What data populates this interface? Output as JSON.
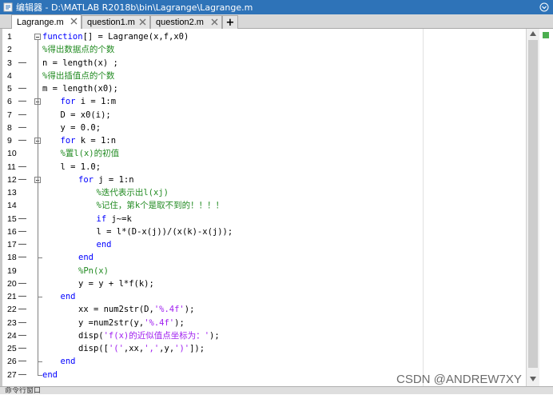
{
  "window": {
    "title": "编辑器 - D:\\MATLAB R2018b\\bin\\Lagrange\\Lagrange.m"
  },
  "tabs": [
    {
      "label": "Lagrange.m",
      "active": true
    },
    {
      "label": "question1.m",
      "active": false
    },
    {
      "label": "question2.m",
      "active": false
    }
  ],
  "tab_add_label": "+",
  "editor": {
    "lines": [
      {
        "n": "1",
        "dash": "",
        "indent": 0,
        "tokens": [
          {
            "c": "kw",
            "t": "function"
          },
          {
            "c": "tx",
            "t": "[] = Lagrange(x,f,x0)"
          }
        ]
      },
      {
        "n": "2",
        "dash": "",
        "indent": 0,
        "tokens": [
          {
            "c": "cm",
            "t": "%得出数据点的个数"
          }
        ]
      },
      {
        "n": "3",
        "dash": "—",
        "indent": 0,
        "tokens": [
          {
            "c": "tx",
            "t": "n = length(x) ;"
          }
        ]
      },
      {
        "n": "4",
        "dash": "",
        "indent": 0,
        "tokens": [
          {
            "c": "cm",
            "t": "%得出插值点的个数"
          }
        ]
      },
      {
        "n": "5",
        "dash": "—",
        "indent": 0,
        "tokens": [
          {
            "c": "tx",
            "t": "m = length(x0);"
          }
        ]
      },
      {
        "n": "6",
        "dash": "—",
        "indent": 1,
        "tokens": [
          {
            "c": "kw",
            "t": "for"
          },
          {
            "c": "tx",
            "t": " i = 1:m"
          }
        ]
      },
      {
        "n": "7",
        "dash": "—",
        "indent": 1,
        "tokens": [
          {
            "c": "tx",
            "t": "D = x0(i);"
          }
        ]
      },
      {
        "n": "8",
        "dash": "—",
        "indent": 1,
        "tokens": [
          {
            "c": "tx",
            "t": "y = 0.0;"
          }
        ]
      },
      {
        "n": "9",
        "dash": "—",
        "indent": 1,
        "tokens": [
          {
            "c": "kw",
            "t": "for"
          },
          {
            "c": "tx",
            "t": " k = 1:n"
          }
        ]
      },
      {
        "n": "10",
        "dash": "",
        "indent": 1,
        "tokens": [
          {
            "c": "cm",
            "t": "%置l(x)的初值"
          }
        ]
      },
      {
        "n": "11",
        "dash": "—",
        "indent": 1,
        "tokens": [
          {
            "c": "tx",
            "t": "l = 1.0;"
          }
        ]
      },
      {
        "n": "12",
        "dash": "—",
        "indent": 2,
        "tokens": [
          {
            "c": "kw",
            "t": "for"
          },
          {
            "c": "tx",
            "t": " j = 1:n"
          }
        ]
      },
      {
        "n": "13",
        "dash": "",
        "indent": 3,
        "tokens": [
          {
            "c": "cm",
            "t": "%迭代表示出l(xj)"
          }
        ]
      },
      {
        "n": "14",
        "dash": "",
        "indent": 3,
        "tokens": [
          {
            "c": "cm",
            "t": "%记住，第k个是取不到的！！！！"
          }
        ]
      },
      {
        "n": "15",
        "dash": "—",
        "indent": 3,
        "tokens": [
          {
            "c": "kw",
            "t": "if"
          },
          {
            "c": "tx",
            "t": " j~=k"
          }
        ]
      },
      {
        "n": "16",
        "dash": "—",
        "indent": 3,
        "tokens": [
          {
            "c": "tx",
            "t": "l = l*(D-x(j))/(x(k)-x(j));"
          }
        ]
      },
      {
        "n": "17",
        "dash": "—",
        "indent": 3,
        "tokens": [
          {
            "c": "kw",
            "t": "end"
          }
        ]
      },
      {
        "n": "18",
        "dash": "—",
        "indent": 2,
        "tokens": [
          {
            "c": "kw",
            "t": "end"
          }
        ]
      },
      {
        "n": "19",
        "dash": "",
        "indent": 2,
        "tokens": [
          {
            "c": "cm",
            "t": "%Pn(x)"
          }
        ]
      },
      {
        "n": "20",
        "dash": "—",
        "indent": 2,
        "tokens": [
          {
            "c": "tx",
            "t": "y = y + l*f(k);"
          }
        ]
      },
      {
        "n": "21",
        "dash": "—",
        "indent": 1,
        "tokens": [
          {
            "c": "kw",
            "t": "end"
          }
        ]
      },
      {
        "n": "22",
        "dash": "—",
        "indent": 2,
        "tokens": [
          {
            "c": "tx",
            "t": "xx = num2str(D,"
          },
          {
            "c": "st",
            "t": "'%.4f'"
          },
          {
            "c": "tx",
            "t": ");"
          }
        ]
      },
      {
        "n": "23",
        "dash": "—",
        "indent": 2,
        "tokens": [
          {
            "c": "tx",
            "t": "y =num2str(y,"
          },
          {
            "c": "st",
            "t": "'%.4f'"
          },
          {
            "c": "tx",
            "t": ");"
          }
        ]
      },
      {
        "n": "24",
        "dash": "—",
        "indent": 2,
        "tokens": [
          {
            "c": "tx",
            "t": "disp("
          },
          {
            "c": "st",
            "t": "'f(x)的近似值点坐标为：'"
          },
          {
            "c": "tx",
            "t": ");"
          }
        ]
      },
      {
        "n": "25",
        "dash": "—",
        "indent": 2,
        "tokens": [
          {
            "c": "tx",
            "t": "disp(["
          },
          {
            "c": "st",
            "t": "'('"
          },
          {
            "c": "tx",
            "t": ",xx,"
          },
          {
            "c": "st",
            "t": "','"
          },
          {
            "c": "tx",
            "t": ",y,"
          },
          {
            "c": "st",
            "t": "')'"
          },
          {
            "c": "tx",
            "t": "]);"
          }
        ]
      },
      {
        "n": "26",
        "dash": "—",
        "indent": 1,
        "tokens": [
          {
            "c": "kw",
            "t": "end"
          }
        ]
      },
      {
        "n": "27",
        "dash": "—",
        "indent": 0,
        "tokens": [
          {
            "c": "kw",
            "t": "end"
          }
        ]
      }
    ]
  },
  "watermark": "CSDN @ANDREW7XY",
  "bottom_panel": {
    "label": "命令行窗口"
  }
}
